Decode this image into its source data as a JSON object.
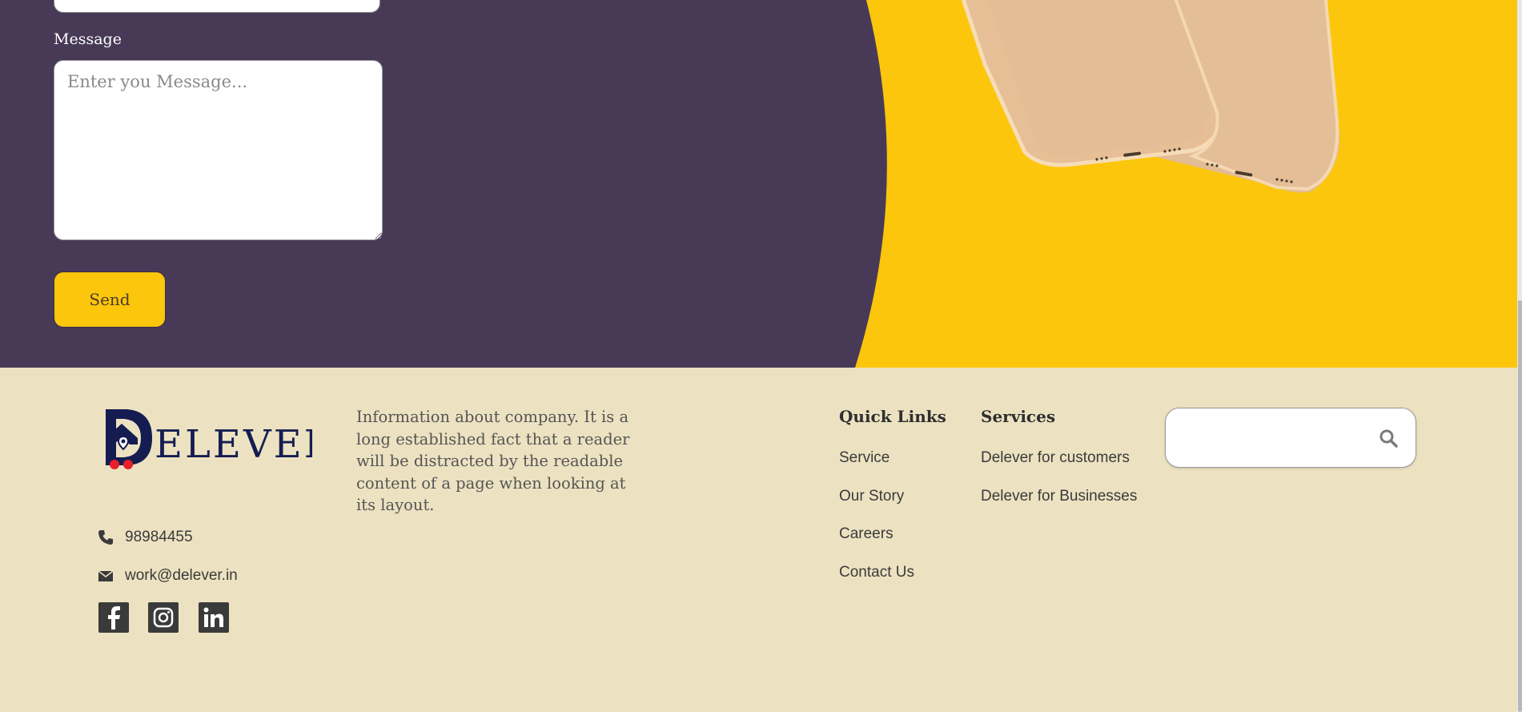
{
  "contact_form": {
    "message_label": "Message",
    "message_placeholder": "Enter you Message...",
    "message_value": "",
    "send_label": "Send"
  },
  "colors": {
    "hero_purple": "#483a57",
    "accent_yellow": "#fcc60c",
    "footer_bg": "#ece2c1",
    "logo_navy": "#141c52",
    "logo_dots_red": "#e8202a"
  },
  "footer": {
    "logo": {
      "text": "ELEVER",
      "icon": "delever-logo-icon"
    },
    "about_text": "Information about company. It is a long established fact that a reader will be distracted by the readable content of a page when looking at its layout.",
    "phone": "98984455",
    "email": "work@delever.in",
    "social": [
      {
        "name": "facebook",
        "icon": "facebook-icon"
      },
      {
        "name": "instagram",
        "icon": "instagram-icon"
      },
      {
        "name": "linkedin",
        "icon": "linkedin-icon"
      }
    ],
    "quick_links": {
      "title": "Quick Links",
      "items": [
        "Service",
        "Our Story",
        "Careers",
        "Contact Us"
      ]
    },
    "services": {
      "title": "Services",
      "items": [
        "Delever for customers",
        "Delever for Businesses"
      ]
    },
    "search": {
      "placeholder": "",
      "value": "",
      "icon": "search-icon"
    }
  }
}
